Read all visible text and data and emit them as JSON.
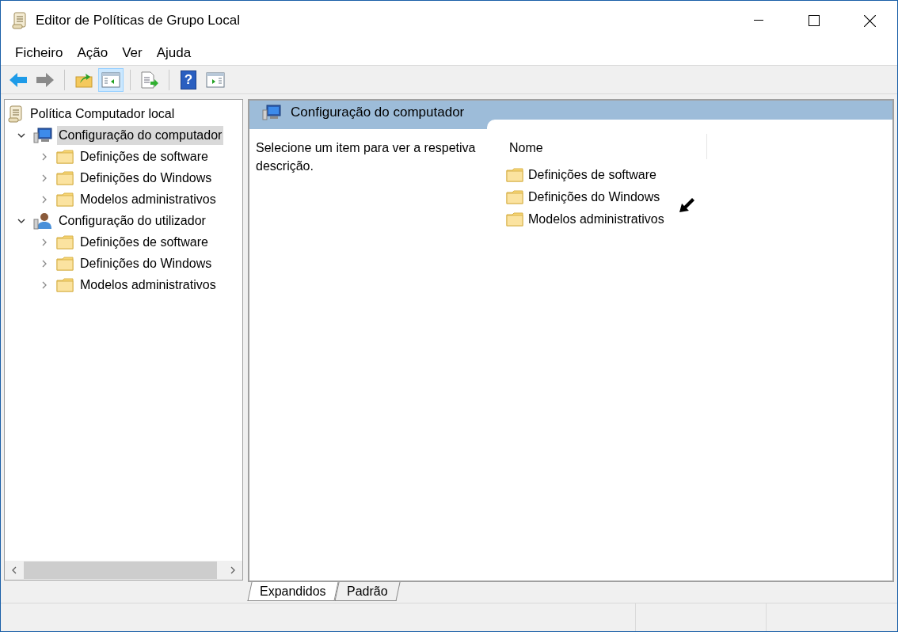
{
  "window": {
    "title": "Editor de Políticas de Grupo Local"
  },
  "menu": [
    {
      "label": "Ficheiro"
    },
    {
      "label": "Ação"
    },
    {
      "label": "Ver"
    },
    {
      "label": "Ajuda"
    }
  ],
  "toolbar": [
    {
      "kind": "back",
      "disabled": false,
      "selected": false
    },
    {
      "kind": "forward",
      "disabled": true,
      "selected": false
    },
    {
      "kind": "separator"
    },
    {
      "kind": "up",
      "disabled": false,
      "selected": false
    },
    {
      "kind": "tree",
      "disabled": false,
      "selected": true
    },
    {
      "kind": "separator"
    },
    {
      "kind": "export",
      "disabled": false,
      "selected": false
    },
    {
      "kind": "separator"
    },
    {
      "kind": "help",
      "glyph": "?",
      "disabled": false,
      "selected": false
    },
    {
      "kind": "pane",
      "disabled": false,
      "selected": false
    }
  ],
  "tree": {
    "label": "Política Computador local",
    "kind": "scroll",
    "children": [
      {
        "label": "Configuração do computador",
        "kind": "computer",
        "expanded": true,
        "selected": true,
        "children": [
          {
            "label": "Definições de software",
            "kind": "folder",
            "expanded": false,
            "selected": false
          },
          {
            "label": "Definições do Windows",
            "kind": "folder",
            "expanded": false,
            "selected": false
          },
          {
            "label": "Modelos administrativos",
            "kind": "folder",
            "expanded": false,
            "selected": false
          }
        ]
      },
      {
        "label": "Configuração do utilizador",
        "kind": "user",
        "expanded": true,
        "selected": false,
        "children": [
          {
            "label": "Definições de software",
            "kind": "folder",
            "expanded": false,
            "selected": false
          },
          {
            "label": "Definições do Windows",
            "kind": "folder",
            "expanded": false,
            "selected": false
          },
          {
            "label": "Modelos administrativos",
            "kind": "folder",
            "expanded": false,
            "selected": false
          }
        ]
      }
    ]
  },
  "details": {
    "header": "Configuração do computador",
    "description": "Selecione um item para ver a respetiva descrição.",
    "columns": [
      "Nome"
    ],
    "items": [
      {
        "label": "Definições de software"
      },
      {
        "label": "Definições do Windows"
      },
      {
        "label": "Modelos administrativos"
      }
    ]
  },
  "tabs": [
    {
      "label": "Expandidos",
      "selected": true
    },
    {
      "label": "Padrão",
      "selected": false
    }
  ]
}
